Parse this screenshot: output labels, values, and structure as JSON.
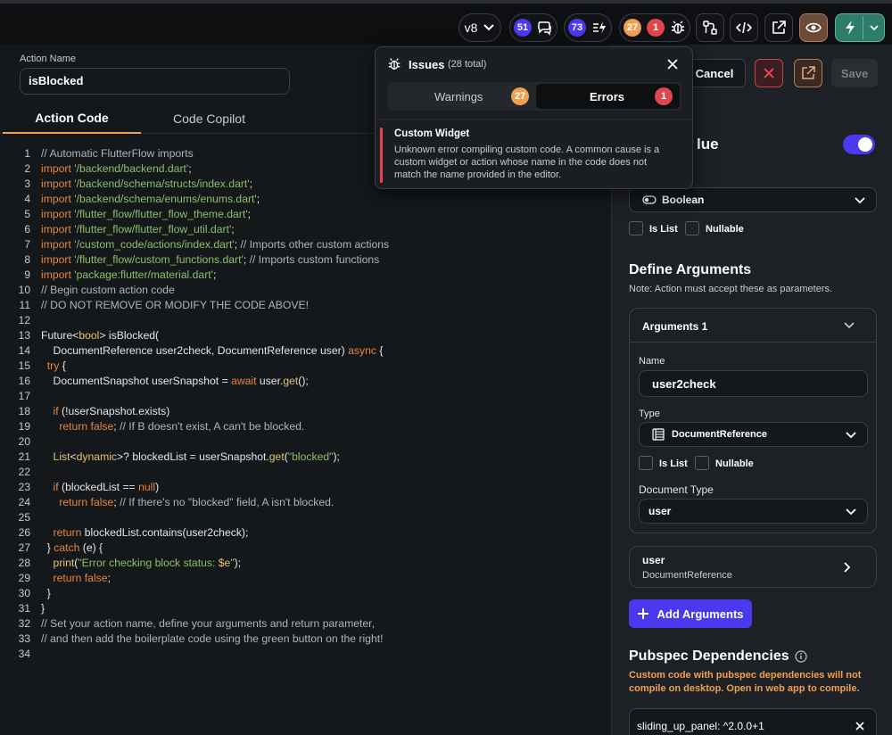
{
  "topbar": {
    "version": "v8",
    "comments_count": "51",
    "flows_count": "73",
    "warnings_count": "27",
    "errors_count": "1"
  },
  "action": {
    "name_label": "Action Name",
    "name_value": "isBlocked",
    "tabs": [
      "Action Code",
      "Code Copilot"
    ]
  },
  "code_lines": [
    [
      {
        "c": "// Automatic FlutterFlow imports",
        "t": "c"
      }
    ],
    [
      {
        "c": "import ",
        "t": "k"
      },
      {
        "c": "'/backend/backend.dart'",
        "t": "s"
      },
      {
        "c": ";",
        "t": "t"
      }
    ],
    [
      {
        "c": "import ",
        "t": "k"
      },
      {
        "c": "'/backend/schema/structs/index.dart'",
        "t": "s"
      },
      {
        "c": ";",
        "t": "t"
      }
    ],
    [
      {
        "c": "import ",
        "t": "k"
      },
      {
        "c": "'/backend/schema/enums/enums.dart'",
        "t": "s"
      },
      {
        "c": ";",
        "t": "t"
      }
    ],
    [
      {
        "c": "import ",
        "t": "k"
      },
      {
        "c": "'/flutter_flow/flutter_flow_theme.dart'",
        "t": "s"
      },
      {
        "c": ";",
        "t": "t"
      }
    ],
    [
      {
        "c": "import ",
        "t": "k"
      },
      {
        "c": "'/flutter_flow/flutter_flow_util.dart'",
        "t": "s"
      },
      {
        "c": ";",
        "t": "t"
      }
    ],
    [
      {
        "c": "import ",
        "t": "k"
      },
      {
        "c": "'/custom_code/actions/index.dart'",
        "t": "s"
      },
      {
        "c": "; ",
        "t": "t"
      },
      {
        "c": "// Imports other custom actions",
        "t": "c"
      }
    ],
    [
      {
        "c": "import ",
        "t": "k"
      },
      {
        "c": "'/flutter_flow/custom_functions.dart'",
        "t": "s"
      },
      {
        "c": "; ",
        "t": "t"
      },
      {
        "c": "// Imports custom functions",
        "t": "c"
      }
    ],
    [
      {
        "c": "import ",
        "t": "k"
      },
      {
        "c": "'package:flutter/material.dart'",
        "t": "s"
      },
      {
        "c": ";",
        "t": "t"
      }
    ],
    [
      {
        "c": "// Begin custom action code",
        "t": "c"
      }
    ],
    [
      {
        "c": "// DO NOT REMOVE OR MODIFY THE CODE ABOVE!",
        "t": "c"
      }
    ],
    [],
    [
      {
        "c": "Future<",
        "t": "t"
      },
      {
        "c": "bool",
        "t": "y"
      },
      {
        "c": "> isBlocked(",
        "t": "t"
      }
    ],
    [
      {
        "c": "    DocumentReference user2check, DocumentReference user) ",
        "t": "t"
      },
      {
        "c": "async",
        "t": "k"
      },
      {
        "c": " {",
        "t": "t"
      }
    ],
    [
      {
        "c": "  ",
        "t": "t"
      },
      {
        "c": "try",
        "t": "k"
      },
      {
        "c": " {",
        "t": "t"
      }
    ],
    [
      {
        "c": "    DocumentSnapshot userSnapshot = ",
        "t": "t"
      },
      {
        "c": "await",
        "t": "k"
      },
      {
        "c": " user.",
        "t": "t"
      },
      {
        "c": "get",
        "t": "y"
      },
      {
        "c": "();",
        "t": "t"
      }
    ],
    [],
    [
      {
        "c": "    ",
        "t": "t"
      },
      {
        "c": "if",
        "t": "k"
      },
      {
        "c": " (!userSnapshot.exists)",
        "t": "t"
      }
    ],
    [
      {
        "c": "      ",
        "t": "t"
      },
      {
        "c": "return false",
        "t": "k"
      },
      {
        "c": "; ",
        "t": "t"
      },
      {
        "c": "// If B doesn't exist, A can't be blocked.",
        "t": "c"
      }
    ],
    [],
    [
      {
        "c": "    ",
        "t": "t"
      },
      {
        "c": "List",
        "t": "y"
      },
      {
        "c": "<",
        "t": "t"
      },
      {
        "c": "dynamic",
        "t": "y"
      },
      {
        "c": ">? blockedList = userSnapshot.",
        "t": "t"
      },
      {
        "c": "get",
        "t": "y"
      },
      {
        "c": "(",
        "t": "t"
      },
      {
        "c": "\"blocked\"",
        "t": "s"
      },
      {
        "c": ");",
        "t": "t"
      }
    ],
    [],
    [
      {
        "c": "    ",
        "t": "t"
      },
      {
        "c": "if",
        "t": "k"
      },
      {
        "c": " (blockedList == ",
        "t": "t"
      },
      {
        "c": "null",
        "t": "k"
      },
      {
        "c": ")",
        "t": "t"
      }
    ],
    [
      {
        "c": "      ",
        "t": "t"
      },
      {
        "c": "return false",
        "t": "k"
      },
      {
        "c": "; ",
        "t": "t"
      },
      {
        "c": "// If there's no \"blocked\" field, A isn't blocked.",
        "t": "c"
      }
    ],
    [],
    [
      {
        "c": "    ",
        "t": "t"
      },
      {
        "c": "return",
        "t": "k"
      },
      {
        "c": " blockedList.contains(user2check);",
        "t": "t"
      }
    ],
    [
      {
        "c": "  } ",
        "t": "t"
      },
      {
        "c": "catch",
        "t": "k"
      },
      {
        "c": " (e) {",
        "t": "t"
      }
    ],
    [
      {
        "c": "    ",
        "t": "t"
      },
      {
        "c": "print",
        "t": "y"
      },
      {
        "c": "(",
        "t": "t"
      },
      {
        "c": "\"Error checking block status: ",
        "t": "s"
      },
      {
        "c": "$e",
        "t": "y"
      },
      {
        "c": "\"",
        "t": "s"
      },
      {
        "c": ");",
        "t": "t"
      }
    ],
    [
      {
        "c": "    ",
        "t": "t"
      },
      {
        "c": "return false",
        "t": "k"
      },
      {
        "c": ";",
        "t": "t"
      }
    ],
    [
      {
        "c": "  }",
        "t": "t"
      }
    ],
    [
      {
        "c": "}",
        "t": "t"
      }
    ],
    [
      {
        "c": "// Set your action name, define your arguments and return parameter,",
        "t": "c"
      }
    ],
    [
      {
        "c": "// and then add the boilerplate code using the green button on the right!",
        "t": "c"
      }
    ],
    []
  ],
  "right": {
    "cancel": "Cancel",
    "save": "Save",
    "return_value_title": "lue",
    "return_type": "Boolean",
    "is_list": "Is List",
    "nullable": "Nullable",
    "define_args_title": "Define Arguments",
    "define_args_note": "Note: Action must accept these as parameters.",
    "argument_header": "Arguments 1",
    "name_label": "Name",
    "name_value": "user2check",
    "type_label": "Type",
    "type_value": "DocumentReference",
    "arg_is_list": "Is List",
    "arg_nullable": "Nullable",
    "doc_type_label": "Document Type",
    "doc_type_value": "user",
    "user_card_title": "user",
    "user_card_sub": "DocumentReference",
    "add_arguments": "Add Arguments",
    "pubspec_title": "Pubspec Dependencies",
    "pubspec_warning": "Custom code with pubspec dependencies will not compile on desktop. Open in web app to compile.",
    "dependency": "sliding_up_panel: ^2.0.0+1"
  },
  "issues": {
    "title": "Issues",
    "total": "(28 total)",
    "warnings_tab": "Warnings",
    "warnings_count": "27",
    "errors_tab": "Errors",
    "errors_count": "1",
    "error_title": "Custom Widget",
    "error_text": "Unknown error compiling custom code. A common cause is a custom widget or action whose name in the code does not match the name provided in the editor."
  },
  "colors": {
    "accent_purple": "#4b39ef",
    "warning_orange": "#f0a052",
    "error_red": "#e0474d",
    "code_keyword": "#e8853a",
    "code_string": "#8fbf6a"
  }
}
